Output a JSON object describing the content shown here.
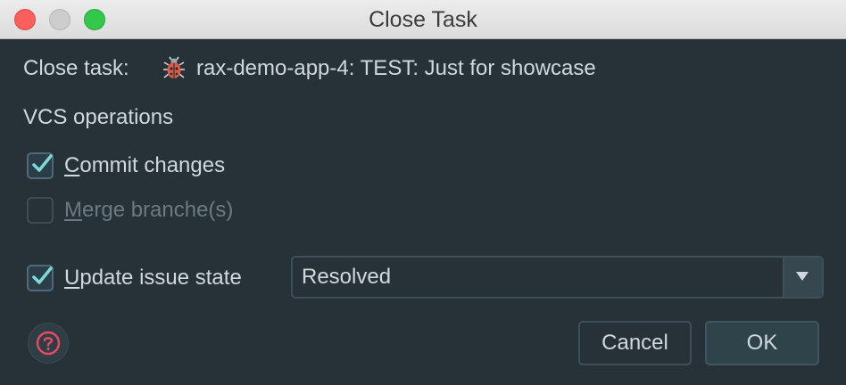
{
  "window": {
    "title": "Close Task"
  },
  "task": {
    "label": "Close task:",
    "name": "rax-demo-app-4: TEST: Just for showcase",
    "icon": "bug-icon"
  },
  "vcs": {
    "heading": "VCS operations",
    "commit": {
      "mnemonic": "C",
      "rest": "ommit changes",
      "checked": true
    },
    "merge": {
      "mnemonic": "M",
      "rest": "erge branche(s)",
      "checked": false,
      "disabled": true
    }
  },
  "issue": {
    "mnemonic": "U",
    "rest": "pdate issue state",
    "checked": true,
    "state_selected": "Resolved"
  },
  "buttons": {
    "help_icon": "help-icon",
    "cancel": "Cancel",
    "ok": "OK"
  },
  "colors": {
    "background": "#263238",
    "text": "#cfd8dc",
    "check": "#7fd8d8",
    "help_accent": "#e64a67"
  }
}
